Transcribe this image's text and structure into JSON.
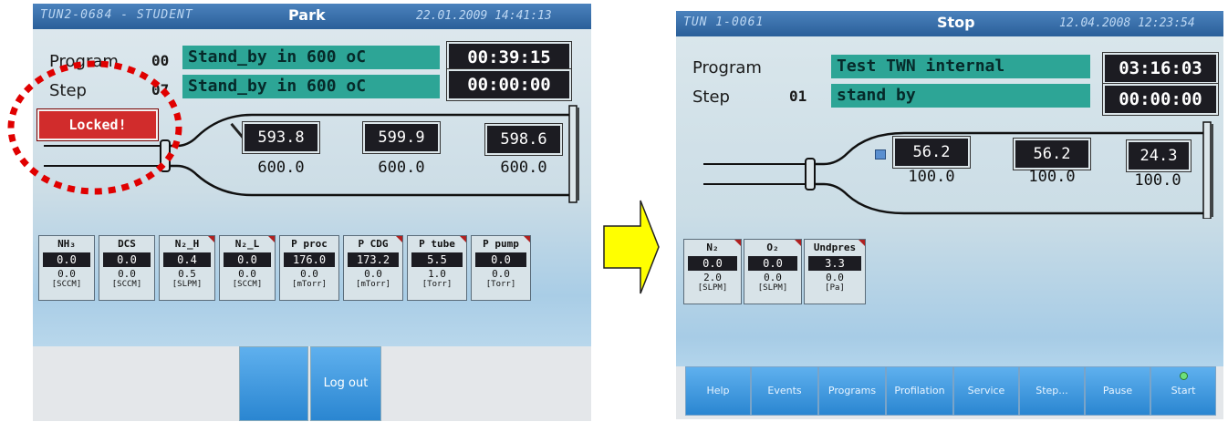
{
  "left_screen": {
    "header": {
      "id_text": "TUN2-0684 - STUDENT",
      "mode": "Park",
      "datetime": "22.01.2009 14:41:13"
    },
    "program": {
      "label": "Program",
      "number": "00",
      "name": "Stand_by in 600 oC",
      "time": "00:39:15"
    },
    "step": {
      "label": "Step",
      "number": "07",
      "name": "Stand_by in 600 oC",
      "time": "00:00:00"
    },
    "locked_label": "Locked!",
    "zones": [
      {
        "actual": "593.8",
        "setpoint": "600.0"
      },
      {
        "actual": "599.9",
        "setpoint": "600.0"
      },
      {
        "actual": "598.6",
        "setpoint": "600.0"
      }
    ],
    "gases": [
      {
        "name": "NH₃",
        "value": "0.0",
        "setpoint": "0.0",
        "unit": "[SCCM]"
      },
      {
        "name": "DCS",
        "value": "0.0",
        "setpoint": "0.0",
        "unit": "[SCCM]"
      },
      {
        "name": "N₂_H",
        "value": "0.4",
        "setpoint": "0.5",
        "unit": "[SLPM]"
      },
      {
        "name": "N₂_L",
        "value": "0.0",
        "setpoint": "0.0",
        "unit": "[SCCM]"
      },
      {
        "name": "P proc",
        "value": "176.0",
        "setpoint": "0.0",
        "unit": "[mTorr]"
      },
      {
        "name": "P CDG",
        "value": "173.2",
        "setpoint": "0.0",
        "unit": "[mTorr]"
      },
      {
        "name": "P tube",
        "value": "5.5",
        "setpoint": "1.0",
        "unit": "[Torr]"
      },
      {
        "name": "P pump",
        "value": "0.0",
        "setpoint": "0.0",
        "unit": "[Torr]"
      }
    ],
    "buttons": {
      "blank": "",
      "logout": "Log out"
    }
  },
  "right_screen": {
    "header": {
      "id_text": "TUN 1-0061",
      "mode": "Stop",
      "datetime": "12.04.2008 12:23:54"
    },
    "program": {
      "label": "Program",
      "number": "",
      "name": "Test TWN internal",
      "time": "03:16:03"
    },
    "step": {
      "label": "Step",
      "number": "01",
      "name": "stand by",
      "time": "00:00:00"
    },
    "zones": [
      {
        "actual": "56.2",
        "setpoint": "100.0"
      },
      {
        "actual": "56.2",
        "setpoint": "100.0"
      },
      {
        "actual": "24.3",
        "setpoint": "100.0"
      }
    ],
    "gases": [
      {
        "name": "N₂",
        "value": "0.0",
        "setpoint": "2.0",
        "unit": "[SLPM]"
      },
      {
        "name": "O₂",
        "value": "0.0",
        "setpoint": "0.0",
        "unit": "[SLPM]"
      },
      {
        "name": "Undpres",
        "value": "3.3",
        "setpoint": "0.0",
        "unit": "[Pa]"
      }
    ],
    "buttons": [
      "Help",
      "Events",
      "Programs",
      "Profilation",
      "Service",
      "Step...",
      "Pause",
      "Start"
    ]
  },
  "colors": {
    "annotation_red": "#e00000",
    "arrow_yellow": "#ffff00",
    "status_green": "#2da596"
  }
}
